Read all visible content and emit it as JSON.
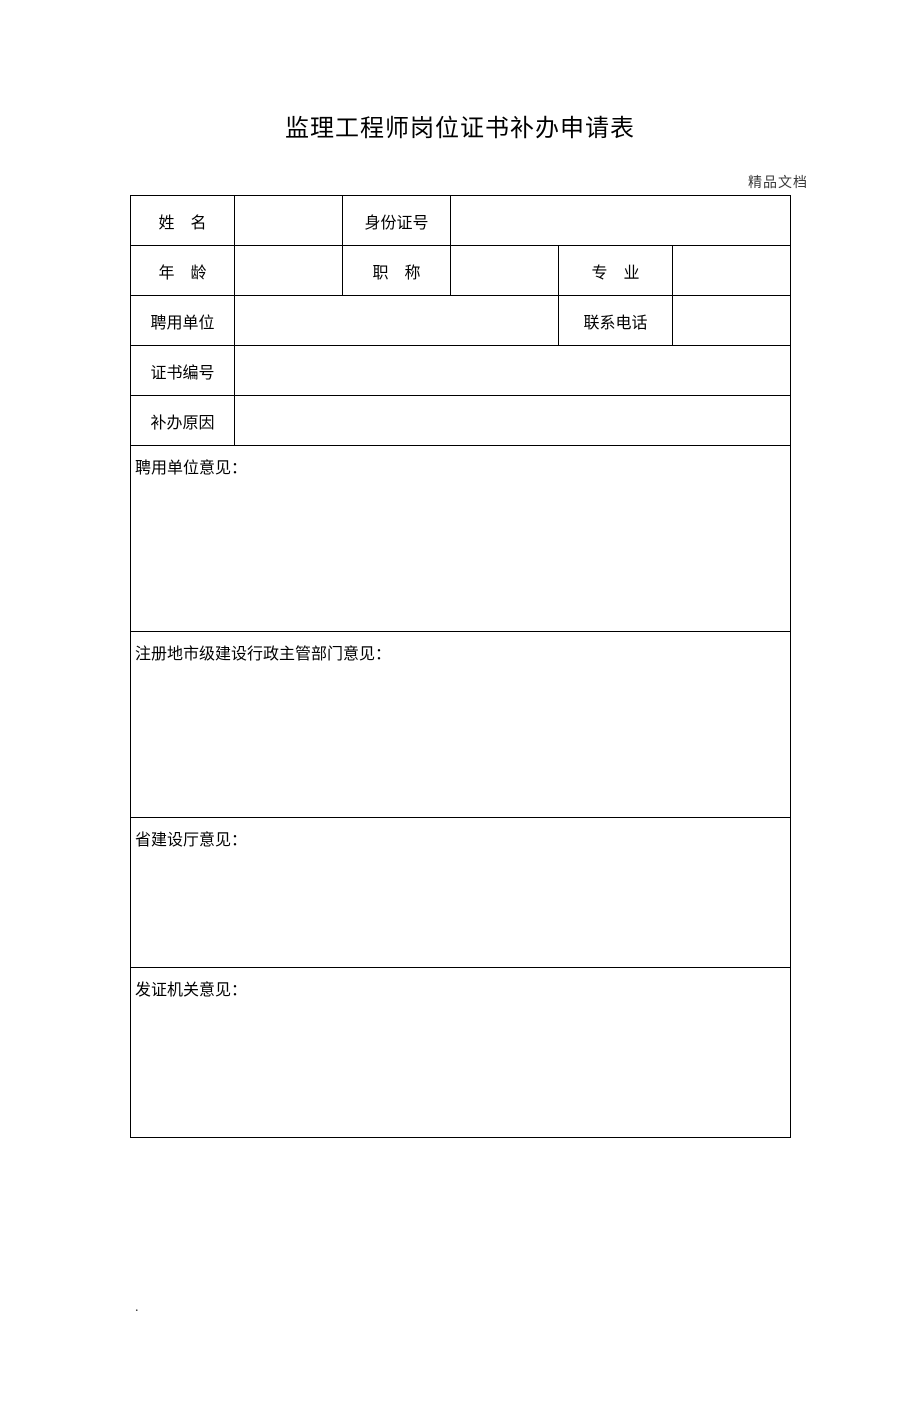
{
  "watermark": "精品文档",
  "title": "监理工程师岗位证书补办申请表",
  "labels": {
    "name": "姓　名",
    "id_number": "身份证号",
    "age": "年　龄",
    "title_rank": "职　称",
    "major": "专　业",
    "employer": "聘用单位",
    "phone": "联系电话",
    "cert_no": "证书编号",
    "reason": "补办原因"
  },
  "sections": {
    "employer_opinion": "聘用单位意见：",
    "city_opinion": "注册地市级建设行政主管部门意见：",
    "province_opinion": "省建设厅意见：",
    "issuer_opinion": "发证机关意见："
  },
  "values": {
    "name": "",
    "id_number": "",
    "age": "",
    "title_rank": "",
    "major": "",
    "employer": "",
    "phone": "",
    "cert_no": "",
    "reason": ""
  },
  "footer": "."
}
